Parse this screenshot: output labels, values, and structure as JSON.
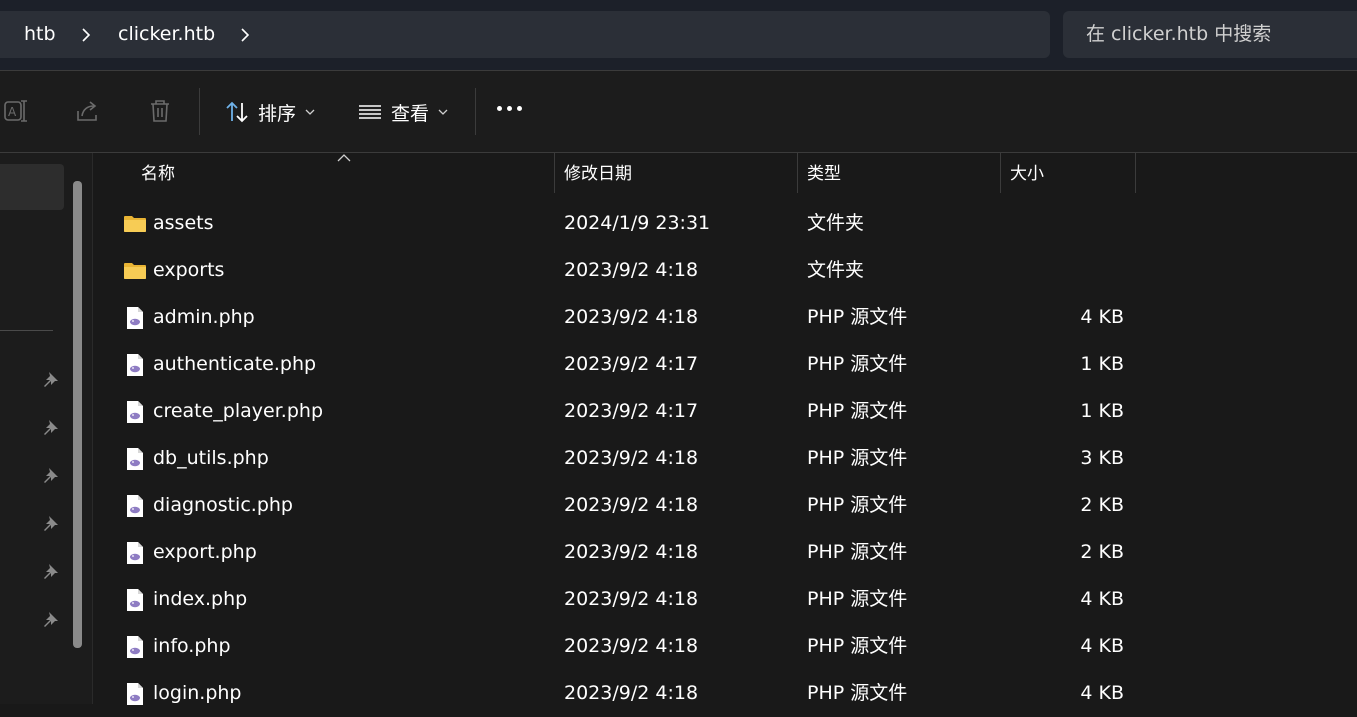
{
  "breadcrumb": {
    "items": [
      "htb",
      "clicker.htb"
    ]
  },
  "search": {
    "placeholder": "在 clicker.htb 中搜索"
  },
  "toolbar": {
    "sort_label": "排序",
    "view_label": "查看"
  },
  "columns": {
    "name": "名称",
    "date": "修改日期",
    "type": "类型",
    "size": "大小"
  },
  "files": [
    {
      "name": "assets",
      "date": "2024/1/9 23:31",
      "type": "文件夹",
      "size": "",
      "icon": "folder-icon"
    },
    {
      "name": "exports",
      "date": "2023/9/2 4:18",
      "type": "文件夹",
      "size": "",
      "icon": "folder-icon"
    },
    {
      "name": "admin.php",
      "date": "2023/9/2 4:18",
      "type": "PHP 源文件",
      "size": "4 KB",
      "icon": "php-file-icon"
    },
    {
      "name": "authenticate.php",
      "date": "2023/9/2 4:17",
      "type": "PHP 源文件",
      "size": "1 KB",
      "icon": "php-file-icon"
    },
    {
      "name": "create_player.php",
      "date": "2023/9/2 4:17",
      "type": "PHP 源文件",
      "size": "1 KB",
      "icon": "php-file-icon"
    },
    {
      "name": "db_utils.php",
      "date": "2023/9/2 4:18",
      "type": "PHP 源文件",
      "size": "3 KB",
      "icon": "php-file-icon"
    },
    {
      "name": "diagnostic.php",
      "date": "2023/9/2 4:18",
      "type": "PHP 源文件",
      "size": "2 KB",
      "icon": "php-file-icon"
    },
    {
      "name": "export.php",
      "date": "2023/9/2 4:18",
      "type": "PHP 源文件",
      "size": "2 KB",
      "icon": "php-file-icon"
    },
    {
      "name": "index.php",
      "date": "2023/9/2 4:18",
      "type": "PHP 源文件",
      "size": "4 KB",
      "icon": "php-file-icon"
    },
    {
      "name": "info.php",
      "date": "2023/9/2 4:18",
      "type": "PHP 源文件",
      "size": "4 KB",
      "icon": "php-file-icon"
    },
    {
      "name": "login.php",
      "date": "2023/9/2 4:18",
      "type": "PHP 源文件",
      "size": "4 KB",
      "icon": "php-file-icon"
    }
  ],
  "colors": {
    "background": "#191919",
    "address_bar": "#2b2f37",
    "folder": "#f4c042",
    "php_glyph": "#8e7cc3"
  }
}
